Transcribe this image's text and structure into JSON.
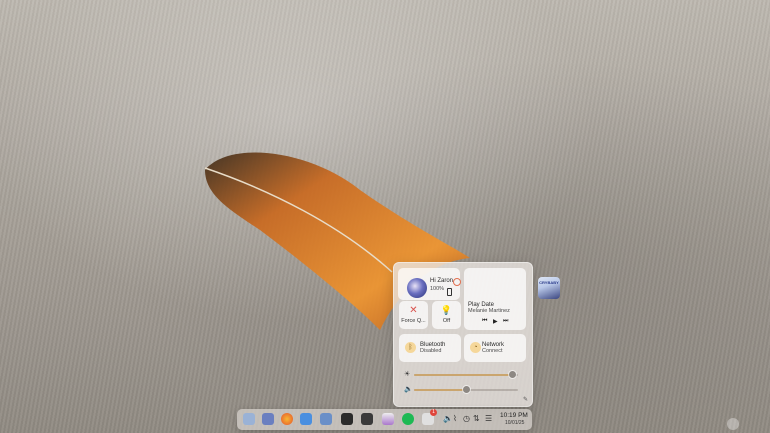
{
  "control_center": {
    "user": {
      "greeting": "Hi Zaron",
      "battery": "100%"
    },
    "media": {
      "title": "Play Date",
      "artist": "Melanie Martinez",
      "album_text": "CRYBABY"
    },
    "quick": [
      {
        "label": "Force Q...",
        "icon": "close-icon"
      },
      {
        "label": "Off",
        "icon": "lightbulb-icon"
      }
    ],
    "bluetooth": {
      "title": "Bluetooth",
      "status": "Disabled"
    },
    "network": {
      "title": "Network",
      "status": "Connect"
    },
    "brightness_level": 0.95,
    "volume_level": 0.5
  },
  "taskbar": {
    "time": "10:19 PM",
    "date": "10/01/25",
    "notification_badge": "1"
  },
  "colors": {
    "accent": "#caa56e",
    "power": "#e07050"
  }
}
